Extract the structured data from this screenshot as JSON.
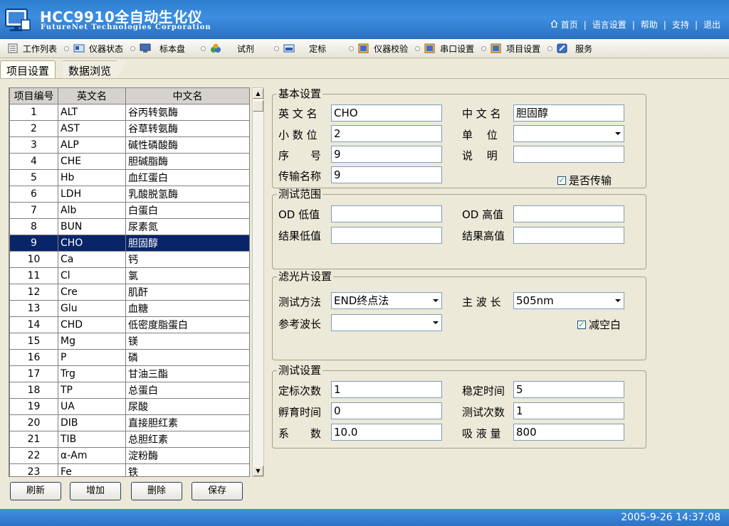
{
  "header": {
    "title": "HCC9910全自动生化仪",
    "subtitle": "FutureNet Technologies Corporation",
    "links": [
      "首页",
      "语言设置",
      "帮助",
      "支持",
      "退出"
    ]
  },
  "toolbar": {
    "items": [
      {
        "label": "工作列表",
        "icon": "worklist-icon"
      },
      {
        "label": "仪器状态",
        "icon": "instrument-status-icon"
      },
      {
        "label": "标本盘",
        "icon": "sample-tray-icon"
      },
      {
        "label": "试剂",
        "icon": "reagent-icon"
      },
      {
        "label": "定标",
        "icon": "calibration-icon"
      },
      {
        "label": "仪器校验",
        "icon": "instrument-check-icon"
      },
      {
        "label": "串口设置",
        "icon": "serial-port-icon"
      },
      {
        "label": "项目设置",
        "icon": "project-settings-icon"
      },
      {
        "label": "服务",
        "icon": "service-icon"
      }
    ]
  },
  "tabs": [
    {
      "label": "项目设置",
      "active": true
    },
    {
      "label": "数据浏览",
      "active": false
    }
  ],
  "grid": {
    "columns": [
      "项目编号",
      "英文名",
      "中文名"
    ],
    "selected_index": 8,
    "rows": [
      [
        "1",
        "ALT",
        "谷丙转氨酶"
      ],
      [
        "2",
        "AST",
        "谷草转氨酶"
      ],
      [
        "3",
        "ALP",
        "碱性磷酸酶"
      ],
      [
        "4",
        "CHE",
        "胆碱脂酶"
      ],
      [
        "5",
        "Hb",
        "血红蛋白"
      ],
      [
        "6",
        "LDH",
        "乳酸脱氢酶"
      ],
      [
        "7",
        "Alb",
        "白蛋白"
      ],
      [
        "8",
        "BUN",
        "尿素氮"
      ],
      [
        "9",
        "CHO",
        "胆固醇"
      ],
      [
        "10",
        "Ca",
        "钙"
      ],
      [
        "11",
        "Cl",
        "氯"
      ],
      [
        "12",
        "Cre",
        "肌酐"
      ],
      [
        "13",
        "Glu",
        "血糖"
      ],
      [
        "14",
        "CHD",
        "低密度脂蛋白"
      ],
      [
        "15",
        "Mg",
        "镁"
      ],
      [
        "16",
        " P",
        "磷"
      ],
      [
        "17",
        "Trg",
        "甘油三酯"
      ],
      [
        "18",
        "TP",
        "总蛋白"
      ],
      [
        "19",
        "UA",
        "尿酸"
      ],
      [
        "20",
        "DIB",
        "直接胆红素"
      ],
      [
        "21",
        "TIB",
        "总胆红素"
      ],
      [
        "22",
        "α-Am",
        "淀粉酶"
      ],
      [
        "23",
        "Fe",
        "铁"
      ]
    ]
  },
  "buttons": {
    "refresh": "刷新",
    "add": "增加",
    "delete": "删除",
    "save": "保存"
  },
  "basic": {
    "title": "基本设置",
    "en_name_label": "英 文 名",
    "en_name": "CHO",
    "cn_name_label": "中 文 名",
    "cn_name": "胆固醇",
    "decimals_label": "小 数 位",
    "decimals": "2",
    "unit_label": "单　 位",
    "unit": "",
    "seq_label": "序　　号",
    "seq": "9",
    "desc_label": "说　 明",
    "desc": "",
    "trans_label": "传输名称",
    "trans": "9",
    "transmit_label": "是否传输",
    "transmit_checked": true
  },
  "range": {
    "title": "测试范围",
    "od_low_label": "OD 低值",
    "od_low": "",
    "od_high_label": "OD 高值",
    "od_high": "",
    "res_low_label": "结果低值",
    "res_low": "",
    "res_high_label": "结果高值",
    "res_high": ""
  },
  "filter": {
    "title": "滤光片设置",
    "method_label": "测试方法",
    "method": "END终点法",
    "main_wl_label": "主 波 长",
    "main_wl": "505nm",
    "ref_wl_label": "参考波长",
    "ref_wl": "",
    "blank_label": "减空白",
    "blank_checked": true
  },
  "test": {
    "title": "测试设置",
    "cal_count_label": "定标次数",
    "cal_count": "1",
    "stable_label": "稳定时间",
    "stable": "5",
    "incub_label": "孵育时间",
    "incub": "0",
    "test_count_label": "测试次数",
    "test_count": "1",
    "coef_label": "系　　数",
    "coef": "10.0",
    "volume_label": "吸 液 量",
    "volume": "800"
  },
  "status": {
    "datetime": "2005-9-26 14:37:08"
  }
}
